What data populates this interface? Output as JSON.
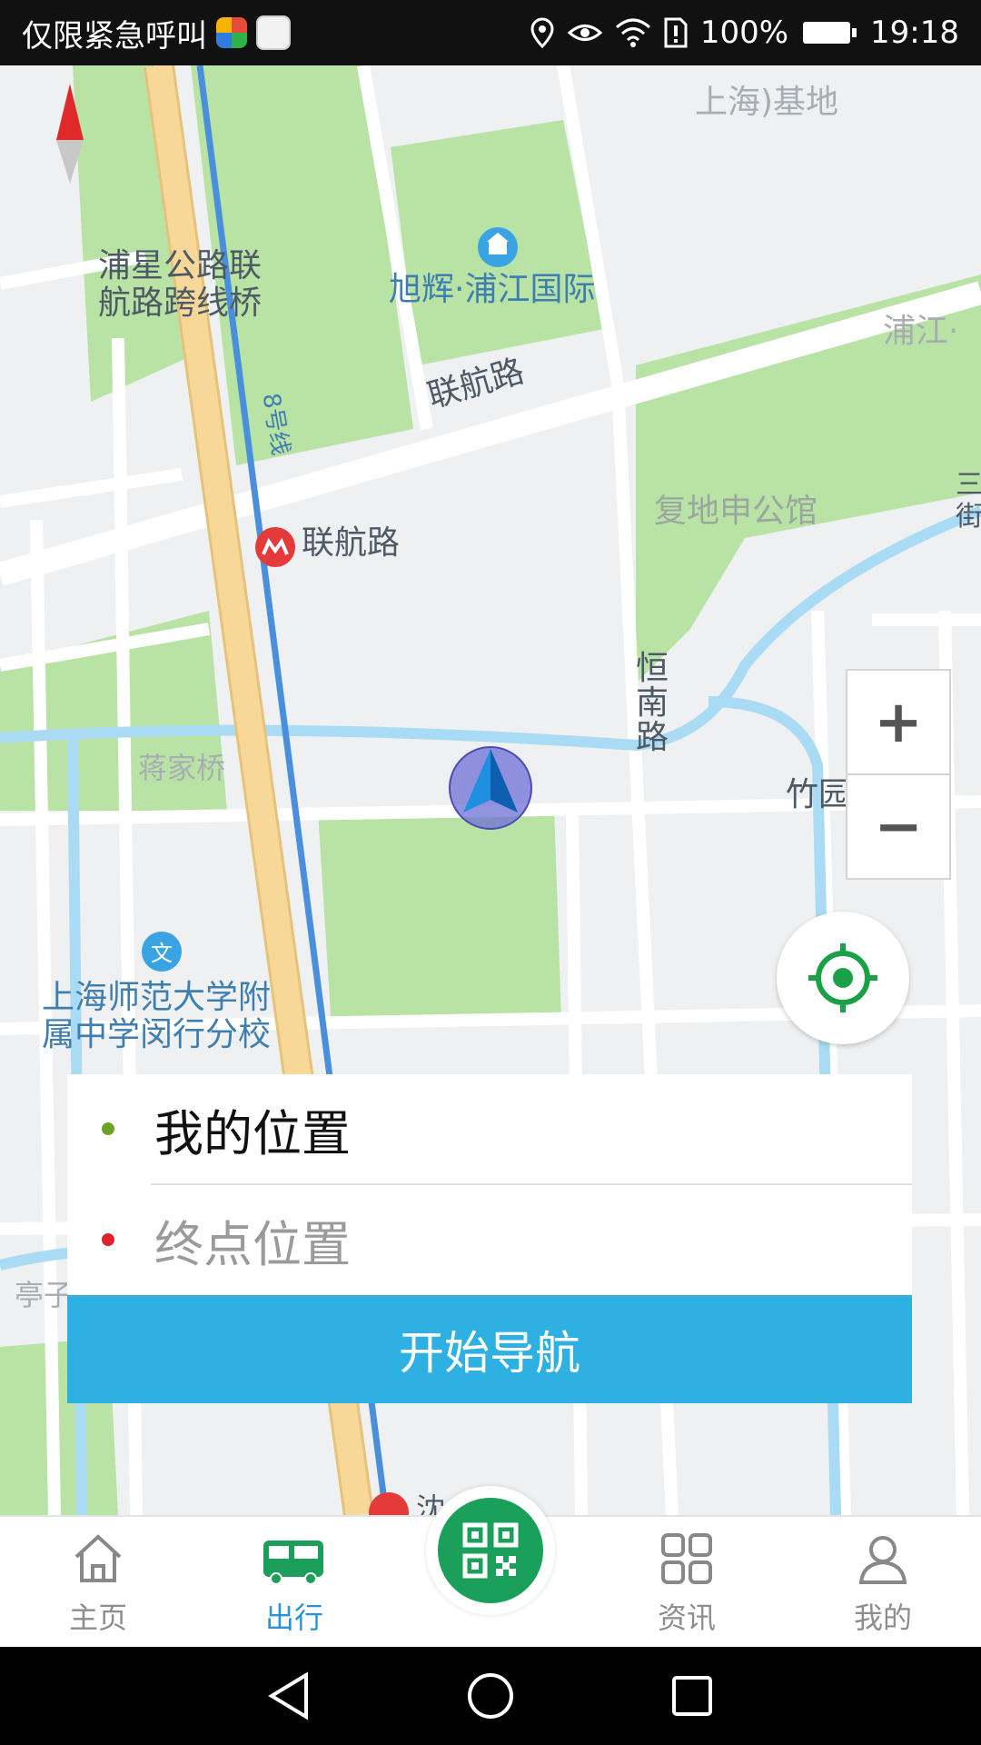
{
  "status_bar": {
    "carrier_text": "仅限紧急呼叫",
    "battery": "100%",
    "time": "19:18",
    "icons": [
      "app-icon-colorful",
      "app-icon-map",
      "location-icon",
      "eye-icon",
      "wifi-icon",
      "sim-alert-icon",
      "battery-icon"
    ]
  },
  "map": {
    "labels": {
      "top_base": "上海)基地",
      "bridge": "浦星公路联\n航路跨线桥",
      "xuhui": "旭辉·浦江国际",
      "road_lianhang": "联航路",
      "metro_line": "8号线",
      "metro_station": "联航路",
      "fudi": "复地申公馆",
      "pujiang_partial": "浦江·",
      "hengnan_road": "恒\n南\n路",
      "jiangjia_bridge": "蒋家桥",
      "zhuyuan_road": "竹园路",
      "school": "上海师范大学附\n属中学闵行分校",
      "tingzi_partial": "亭子",
      "bottom_station_partial": "沈…路",
      "right_edge_partial": "三\n街"
    },
    "scale": "200m",
    "compass": "north-compass-icon",
    "zoom_in": "+",
    "zoom_out": "−",
    "locate_icon": "locate-target-icon",
    "colors": {
      "green_area": "#b9e2a5",
      "road": "#ffffff",
      "highway": "#f7d898",
      "metro": "#4a8fdc",
      "water": "#a9dbf4",
      "marker": "#2a7fd6"
    }
  },
  "route_panel": {
    "origin": "我的位置",
    "destination_placeholder": "终点位置",
    "origin_dot_color": "#6aa422",
    "destination_dot_color": "#e0202a",
    "start_button": "开始导航"
  },
  "bottom_nav": {
    "tabs": [
      {
        "label": "主页",
        "icon": "home-icon"
      },
      {
        "label": "出行",
        "icon": "bus-icon",
        "active": true
      },
      {
        "label": "资讯",
        "icon": "grid-icon"
      },
      {
        "label": "我的",
        "icon": "user-icon"
      }
    ],
    "center_button_icon": "qr-code-icon"
  }
}
